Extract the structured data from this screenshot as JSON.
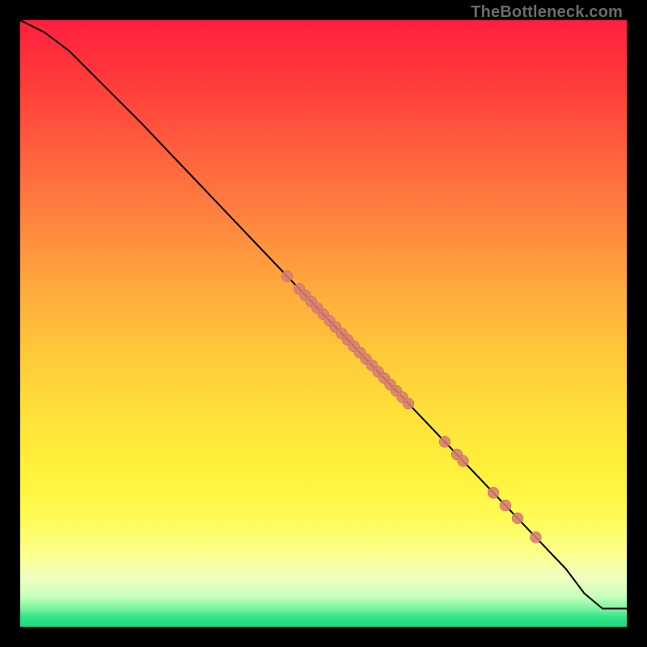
{
  "watermark": "TheBottleneck.com",
  "chart_data": {
    "type": "line",
    "title": "",
    "xlabel": "",
    "ylabel": "",
    "xlim": [
      0,
      100
    ],
    "ylim": [
      0,
      100
    ],
    "line": {
      "x": [
        0,
        4,
        8,
        12,
        20,
        30,
        40,
        50,
        60,
        70,
        80,
        90,
        93,
        96,
        100
      ],
      "y": [
        100,
        98,
        95,
        91,
        83,
        72.5,
        62,
        51.5,
        41,
        30.5,
        20,
        9.5,
        5.5,
        3,
        3
      ]
    },
    "points": {
      "x": [
        44,
        46,
        47,
        48,
        49,
        50,
        51,
        52,
        53,
        54,
        55,
        56,
        57,
        58,
        59,
        60,
        61,
        62,
        63,
        64,
        70,
        72,
        73,
        78,
        80,
        82,
        85
      ],
      "y": [
        57.8,
        55.7,
        54.65,
        53.6,
        52.55,
        51.5,
        50.45,
        49.4,
        48.35,
        47.3,
        46.25,
        45.2,
        44.15,
        43.1,
        42.05,
        41,
        39.95,
        38.9,
        37.85,
        36.8,
        30.5,
        28.4,
        27.35,
        22.1,
        20,
        17.9,
        14.75
      ]
    },
    "colors": {
      "line": "#000000",
      "point_fill": "#d77d72",
      "point_stroke": "#c76a5f"
    }
  }
}
